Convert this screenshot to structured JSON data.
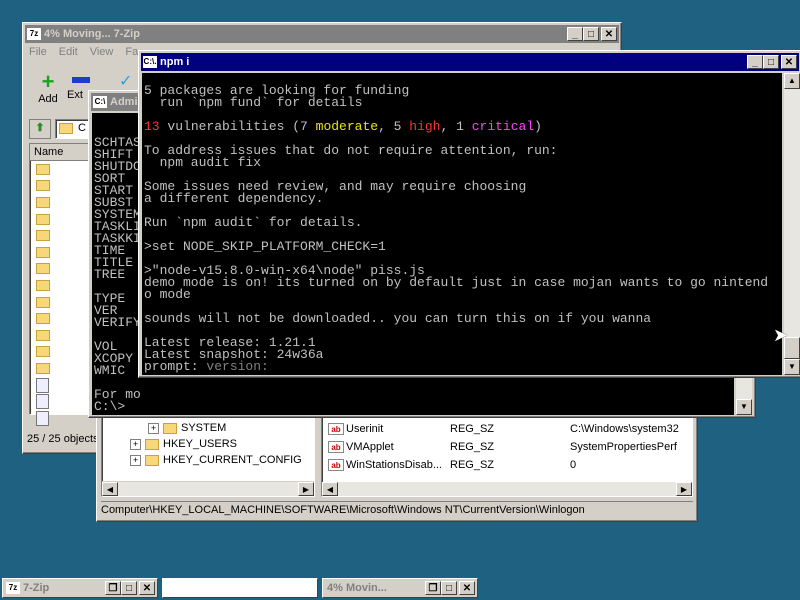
{
  "zip_window": {
    "title": "4% Moving... 7-Zip",
    "menu": [
      "File",
      "Edit",
      "View",
      "Fa"
    ],
    "toolbar": [
      {
        "label": "Add",
        "icon": "plus-icon"
      },
      {
        "label": "Ext",
        "icon": "minus-icon"
      }
    ],
    "path_value": "C",
    "column_name": "Name",
    "status": "25 / 25 objects"
  },
  "admin_window": {
    "title": "Admi",
    "lines": [
      "SCHTAS",
      "SHIFT",
      "SHUTDO",
      "SORT",
      "START",
      "SUBST",
      "SYSTEM",
      "TASKLI",
      "TASKKI",
      "TIME",
      "TITLE",
      "TREE",
      "",
      "TYPE",
      "VER",
      "VERIFY",
      "",
      "VOL",
      "XCOPY",
      "WMIC",
      "",
      "For mo"
    ],
    "prompt": "C:\\>"
  },
  "npm_window": {
    "title": "npm i",
    "icon_label": "C:\\.",
    "lines": [
      [
        {
          "t": "5 packages are looking for funding",
          "c": ""
        }
      ],
      [
        {
          "t": "  run `npm fund` for details",
          "c": ""
        }
      ],
      [
        {
          "t": "",
          "c": ""
        }
      ],
      [
        {
          "t": "13",
          "c": "red"
        },
        {
          "t": " vulnerabilities (7 ",
          "c": ""
        },
        {
          "t": "moderate",
          "c": "yellow"
        },
        {
          "t": ", 5 ",
          "c": ""
        },
        {
          "t": "high",
          "c": "red"
        },
        {
          "t": ", 1 ",
          "c": ""
        },
        {
          "t": "critical",
          "c": "mag"
        },
        {
          "t": ")",
          "c": ""
        }
      ],
      [
        {
          "t": "",
          "c": ""
        }
      ],
      [
        {
          "t": "To address issues that do not require attention, run:",
          "c": ""
        }
      ],
      [
        {
          "t": "  npm audit fix",
          "c": ""
        }
      ],
      [
        {
          "t": "",
          "c": ""
        }
      ],
      [
        {
          "t": "Some issues need review, and may require choosing",
          "c": ""
        }
      ],
      [
        {
          "t": "a different dependency.",
          "c": ""
        }
      ],
      [
        {
          "t": "",
          "c": ""
        }
      ],
      [
        {
          "t": "Run `npm audit` for details.",
          "c": ""
        }
      ],
      [
        {
          "t": "",
          "c": ""
        }
      ],
      [
        {
          "t": ">set NODE_SKIP_PLATFORM_CHECK=1",
          "c": ""
        }
      ],
      [
        {
          "t": "",
          "c": ""
        }
      ],
      [
        {
          "t": ">\"node-v15.8.0-win-x64\\node\" piss.js",
          "c": ""
        }
      ],
      [
        {
          "t": "demo mode is on! its turned on by default just in case mojan wants to go nintend",
          "c": ""
        }
      ],
      [
        {
          "t": "o mode",
          "c": ""
        }
      ],
      [
        {
          "t": "",
          "c": ""
        }
      ],
      [
        {
          "t": "sounds will not be downloaded.. you can turn this on if you wanna",
          "c": ""
        }
      ],
      [
        {
          "t": "",
          "c": ""
        }
      ],
      [
        {
          "t": "Latest release: 1.21.1",
          "c": ""
        }
      ],
      [
        {
          "t": "Latest snapshot: 24w36a",
          "c": ""
        }
      ],
      [
        {
          "t": "prompt: ",
          "c": ""
        },
        {
          "t": "version:",
          "c": "gray"
        }
      ]
    ]
  },
  "regedit_window": {
    "tree": [
      {
        "label": "SYSTEM",
        "expander": "+"
      },
      {
        "label": "HKEY_USERS",
        "expander": "+"
      },
      {
        "label": "HKEY_CURRENT_CONFIG",
        "expander": "+"
      }
    ],
    "values": [
      {
        "name": "Userinit",
        "type": "REG_SZ",
        "data": "C:\\Windows\\system32"
      },
      {
        "name": "VMApplet",
        "type": "REG_SZ",
        "data": "SystemPropertiesPerf"
      },
      {
        "name": "WinStationsDisab...",
        "type": "REG_SZ",
        "data": "0"
      }
    ],
    "status_path": "Computer\\HKEY_LOCAL_MACHINE\\SOFTWARE\\Microsoft\\Windows NT\\CurrentVersion\\Winlogon"
  },
  "taskbar": {
    "items": [
      {
        "label": "7-Zip"
      },
      {
        "label": ""
      },
      {
        "label": "4% Movin..."
      }
    ]
  }
}
